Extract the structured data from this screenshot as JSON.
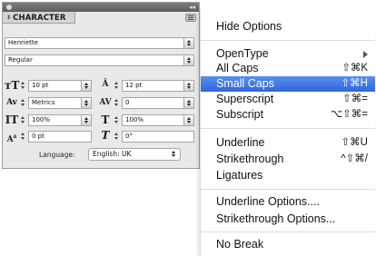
{
  "panel": {
    "tab_label": "CHARACTER",
    "collapse_glyph": "◂◂",
    "font_family": "Henriette",
    "font_style": "Regular",
    "font_size": "10 pt",
    "leading": "12 pt",
    "kerning": "Metrics",
    "tracking": "0",
    "vertical_scale": "100%",
    "horizontal_scale": "100%",
    "baseline_shift": "0 pt",
    "skew": "0°",
    "language_label": "Language:",
    "language_value": "English: UK"
  },
  "menu": {
    "hide_options": "Hide Options",
    "opentype": "OpenType",
    "all_caps": "All Caps",
    "all_caps_shortcut": "⇧⌘K",
    "small_caps": "Small Caps",
    "small_caps_shortcut": "⇧⌘H",
    "superscript": "Superscript",
    "superscript_shortcut": "⇧⌘=",
    "subscript": "Subscript",
    "subscript_shortcut": "⌥⇧⌘=",
    "underline": "Underline",
    "underline_shortcut": "⇧⌘U",
    "strikethrough": "Strikethrough",
    "strikethrough_shortcut": "^⇧⌘/",
    "ligatures": "Ligatures",
    "underline_options": "Underline Options....",
    "strikethrough_options": "Strikethrough Options...",
    "no_break": "No Break"
  },
  "colors": {
    "selection": "#3b74e0",
    "panel_bg": "#e9e9e9"
  }
}
